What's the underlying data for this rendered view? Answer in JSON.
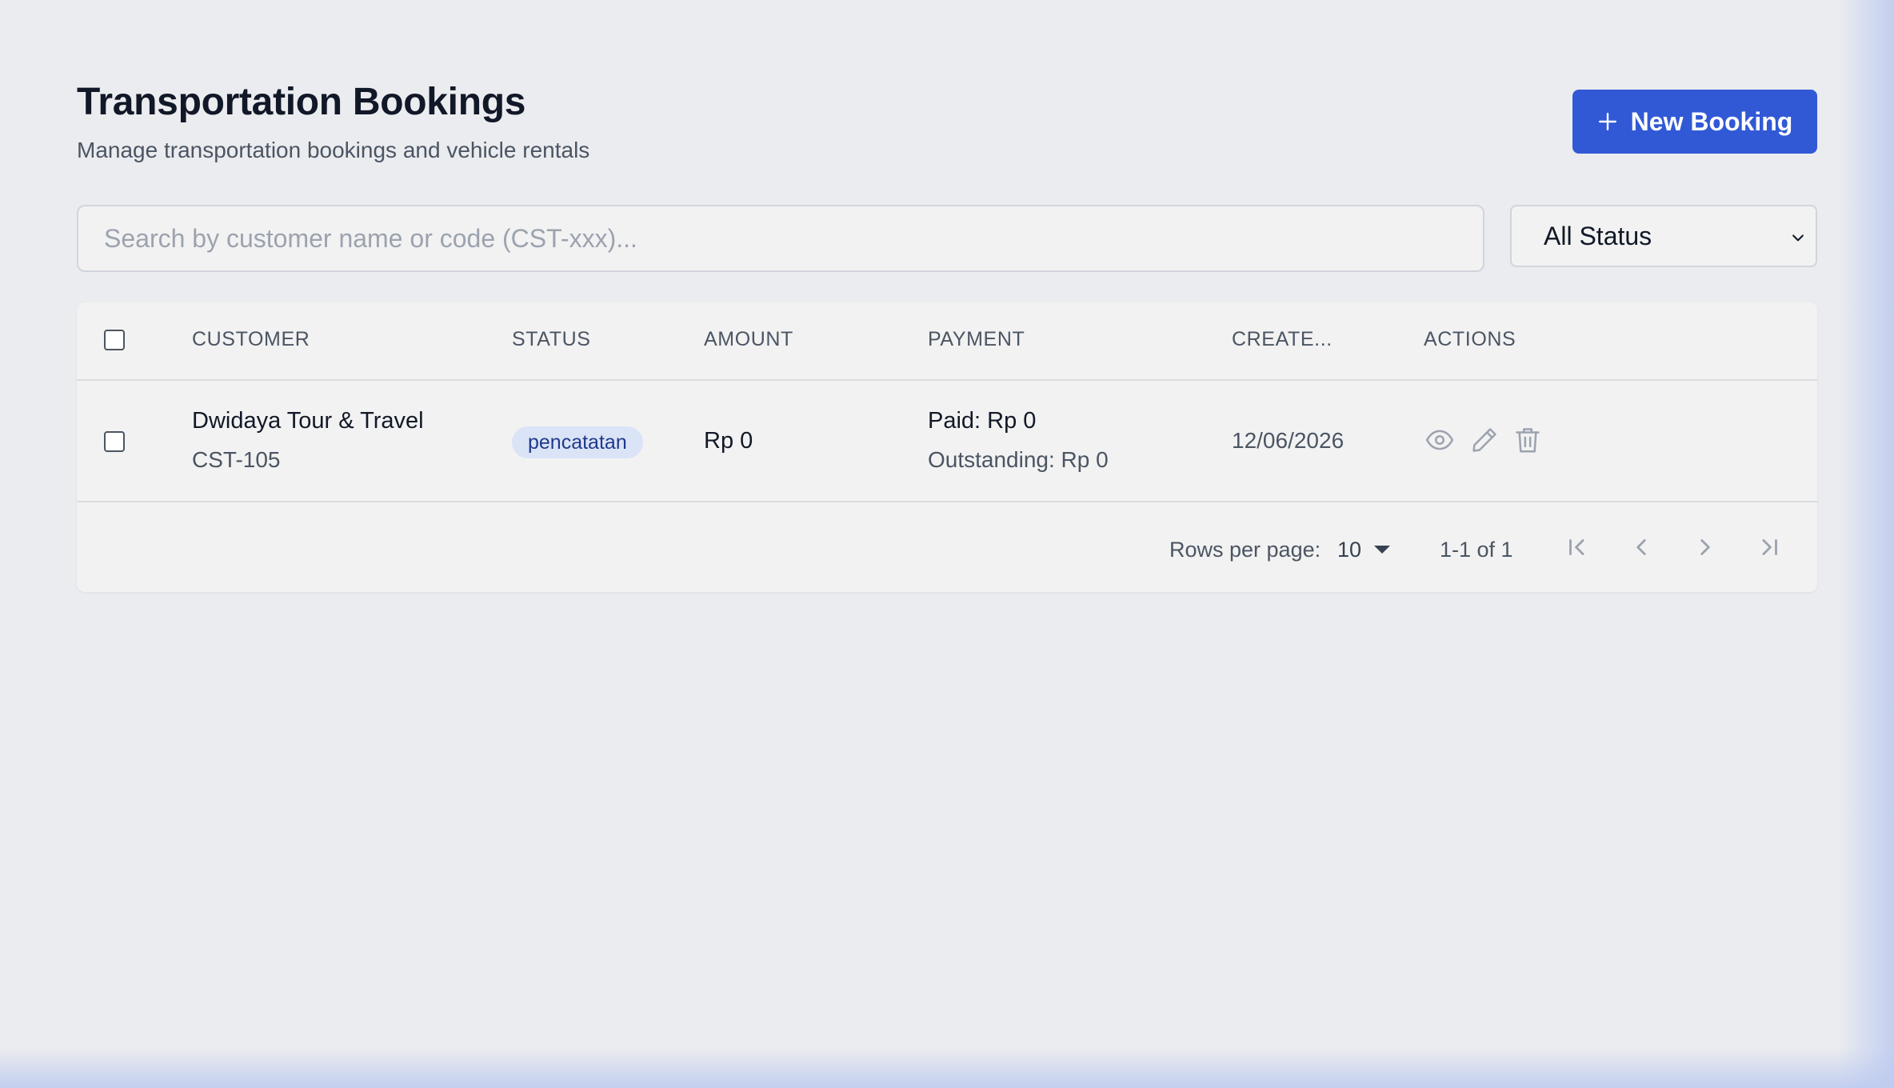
{
  "header": {
    "title": "Transportation Bookings",
    "subtitle": "Manage transportation bookings and vehicle rentals",
    "new_booking_label": "New Booking"
  },
  "filters": {
    "search_placeholder": "Search by customer name or code (CST-xxx)...",
    "search_value": "",
    "status_selected": "All Status"
  },
  "table": {
    "columns": [
      "CUSTOMER",
      "STATUS",
      "AMOUNT",
      "PAYMENT",
      "CREATE...",
      "ACTIONS"
    ],
    "rows": [
      {
        "customer_name": "Dwidaya Tour & Travel",
        "customer_code": "CST-105",
        "status": "pencatatan",
        "amount": "Rp 0",
        "paid": "Paid: Rp 0",
        "outstanding": "Outstanding: Rp 0",
        "created": "12/06/2026",
        "actions": [
          "eye-icon",
          "pencil-icon",
          "trash-icon"
        ]
      }
    ]
  },
  "pagination": {
    "rows_per_page_label": "Rows per page:",
    "rows_per_page_value": "10",
    "range_text": "1-1 of 1"
  },
  "colors": {
    "accent": "#3159d6",
    "badge_bg": "#dbe3f7",
    "badge_text": "#1e3a8a"
  }
}
